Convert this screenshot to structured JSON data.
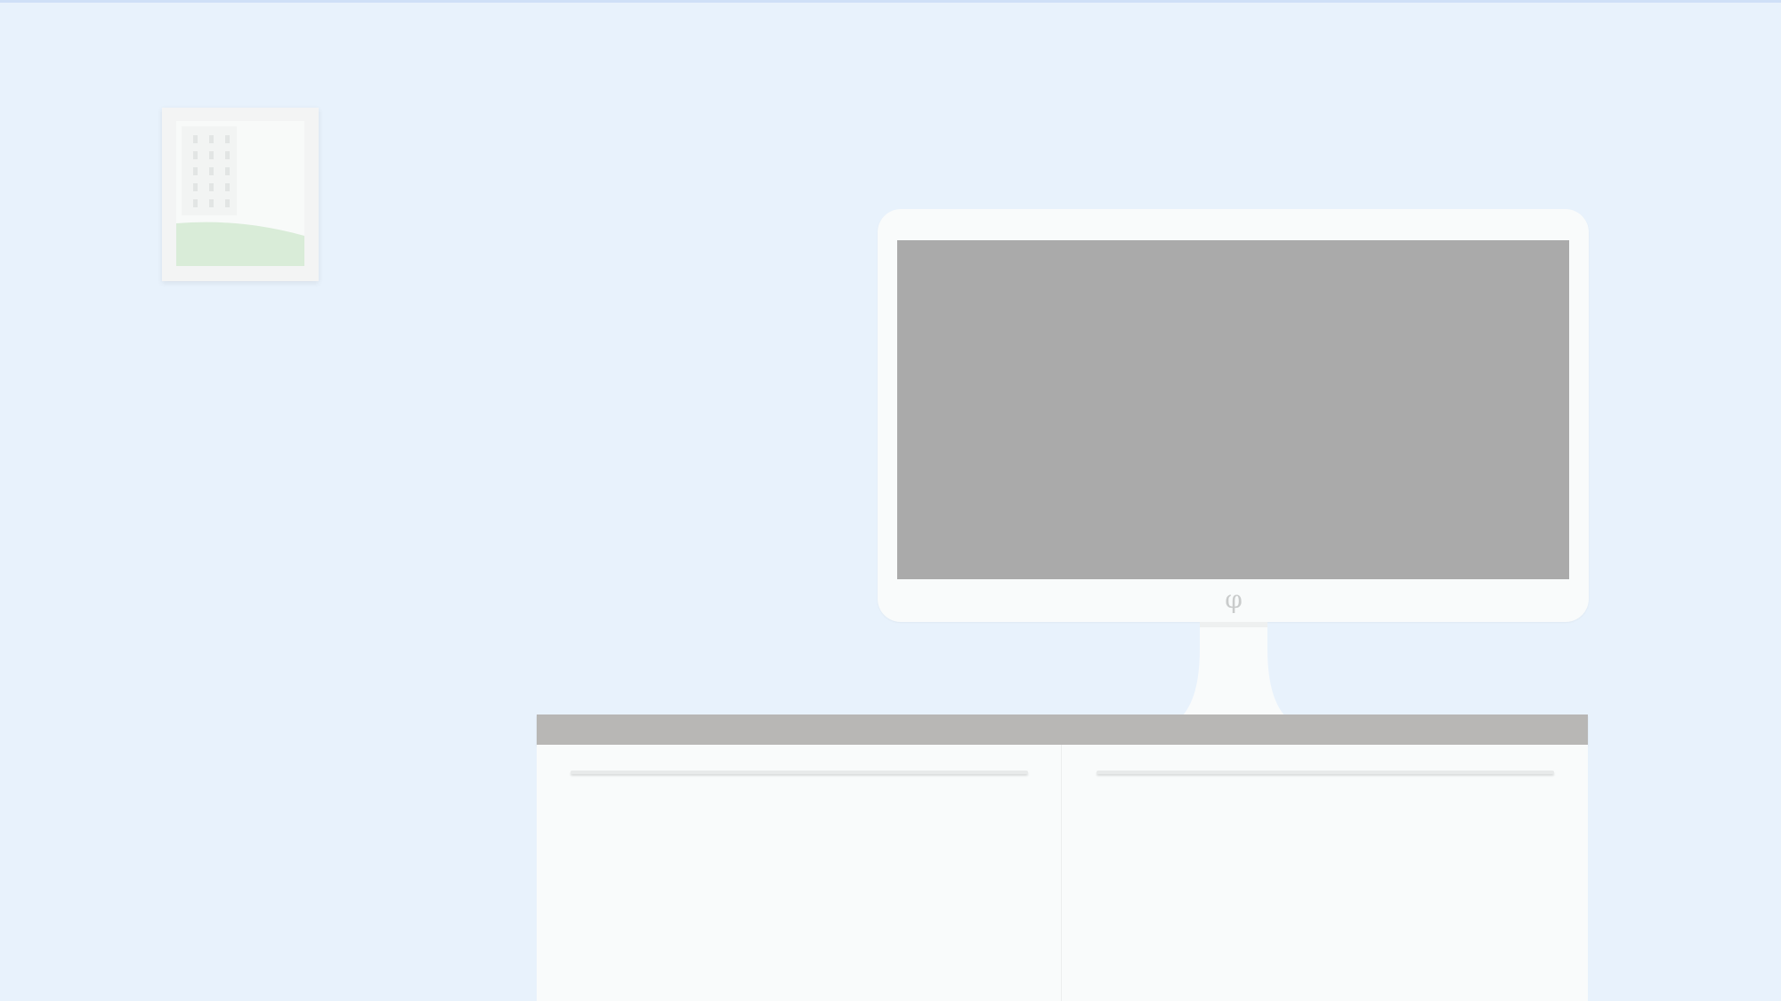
{
  "scene": {
    "wall_color": "#e8f2fc",
    "picture": {
      "frame_color": "#f3f4f4",
      "building_window_color": "#e2e5e4",
      "hill_color": "#d9ecd8"
    },
    "monitor": {
      "bezel_color": "#f9fbfb",
      "screen_color": "#aaaaaa",
      "logo_glyph": "φ",
      "screen_on": false
    },
    "cabinet": {
      "top_color": "#b8b7b5",
      "body_color": "#f9fbfb",
      "doors": [
        "left",
        "right"
      ]
    }
  }
}
